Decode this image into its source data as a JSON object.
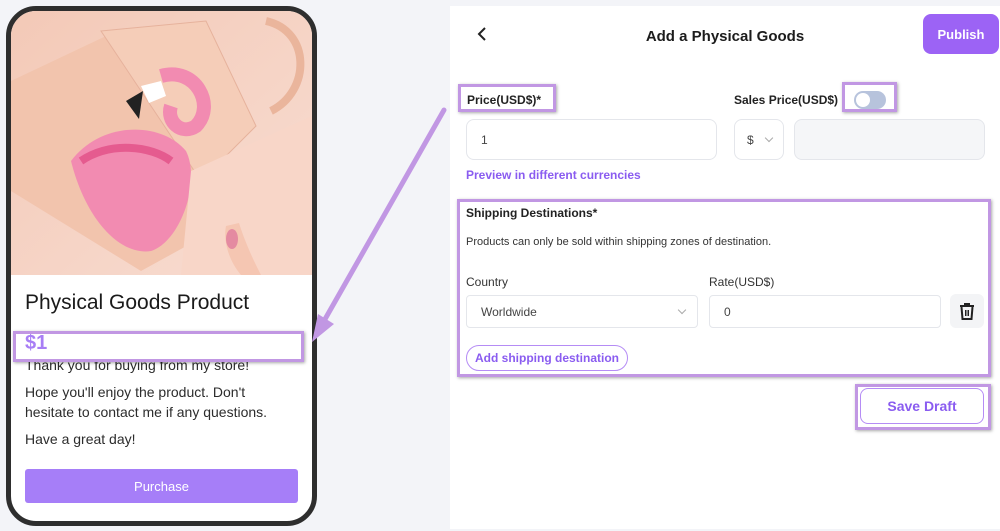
{
  "preview": {
    "product_title": "Physical Goods Product",
    "price": "$1",
    "description": [
      "Thank you for buying from my store!",
      "Hope you'll enjoy the product. Don't hesitate to contact me if any questions.",
      "Have a great day!"
    ],
    "purchase_label": "Purchase",
    "image_alt": "Pink flamingo leather wallet in hand"
  },
  "header": {
    "title": "Add a Physical Goods",
    "publish_label": "Publish",
    "back_icon": "chevron-left-icon"
  },
  "pricing": {
    "price_label": "Price(USD$)*",
    "price_value": "1",
    "sales_price_label": "Sales Price(USD$)",
    "sales_price_enabled": false,
    "currency_symbol": "$",
    "sales_price_value": "",
    "preview_link": "Preview in different currencies"
  },
  "shipping": {
    "title": "Shipping Destinations*",
    "helper": "Products can only be sold within shipping zones of destination.",
    "country_label": "Country",
    "rate_label": "Rate(USD$)",
    "destinations": [
      {
        "country": "Worldwide",
        "rate": "0"
      }
    ],
    "add_label": "Add shipping destination",
    "delete_icon": "trash-icon"
  },
  "footer": {
    "save_draft_label": "Save Draft"
  },
  "colors": {
    "accent": "#9c63f5",
    "annotation": "#c197e3",
    "purchase": "#a67ef8"
  }
}
